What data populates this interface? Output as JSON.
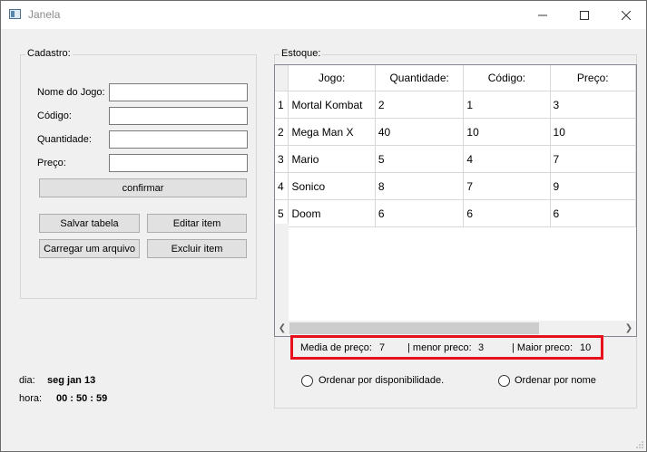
{
  "window": {
    "title": "Janela"
  },
  "cadastro": {
    "title": "Cadastro:",
    "fields": {
      "nome": "Nome do Jogo:",
      "codigo": "Código:",
      "quantidade": "Quantidade:",
      "preco": "Preço:"
    },
    "confirm_label": "confirmar",
    "buttons": {
      "salvar": "Salvar tabela",
      "editar": "Editar item",
      "carregar": "Carregar um arquivo",
      "excluir": "Excluir item"
    }
  },
  "date": {
    "dia_label": "dia:",
    "dia_value": "seg jan 13",
    "hora_label": "hora:",
    "hora_value": "00 : 50 : 59"
  },
  "estoque": {
    "title": "Estoque:",
    "columns": [
      "Jogo:",
      "Quantidade:",
      "Código:",
      "Preço:"
    ],
    "rows": [
      {
        "num": "1",
        "jogo": "Mortal Kombat",
        "quantidade": "2",
        "codigo": "1",
        "preco": "3"
      },
      {
        "num": "2",
        "jogo": "Mega Man X",
        "quantidade": "40",
        "codigo": "10",
        "preco": "10"
      },
      {
        "num": "3",
        "jogo": "Mario",
        "quantidade": "5",
        "codigo": "4",
        "preco": "7"
      },
      {
        "num": "4",
        "jogo": "Sonico",
        "quantidade": "8",
        "codigo": "7",
        "preco": "9"
      },
      {
        "num": "5",
        "jogo": "Doom",
        "quantidade": "6",
        "codigo": "6",
        "preco": "6"
      }
    ]
  },
  "stats": {
    "media_label": "Media de preço:",
    "media_value": "7",
    "menor_label": "| menor preco:",
    "menor_value": "3",
    "maior_label": "| Maior preco:",
    "maior_value": "10"
  },
  "ordering": {
    "disponibilidade": "Ordenar por disponibilidade.",
    "nome": "Ordenar por nome"
  },
  "colors": {
    "highlight": "#e8101c",
    "window_bg": "#f0f0f0"
  }
}
